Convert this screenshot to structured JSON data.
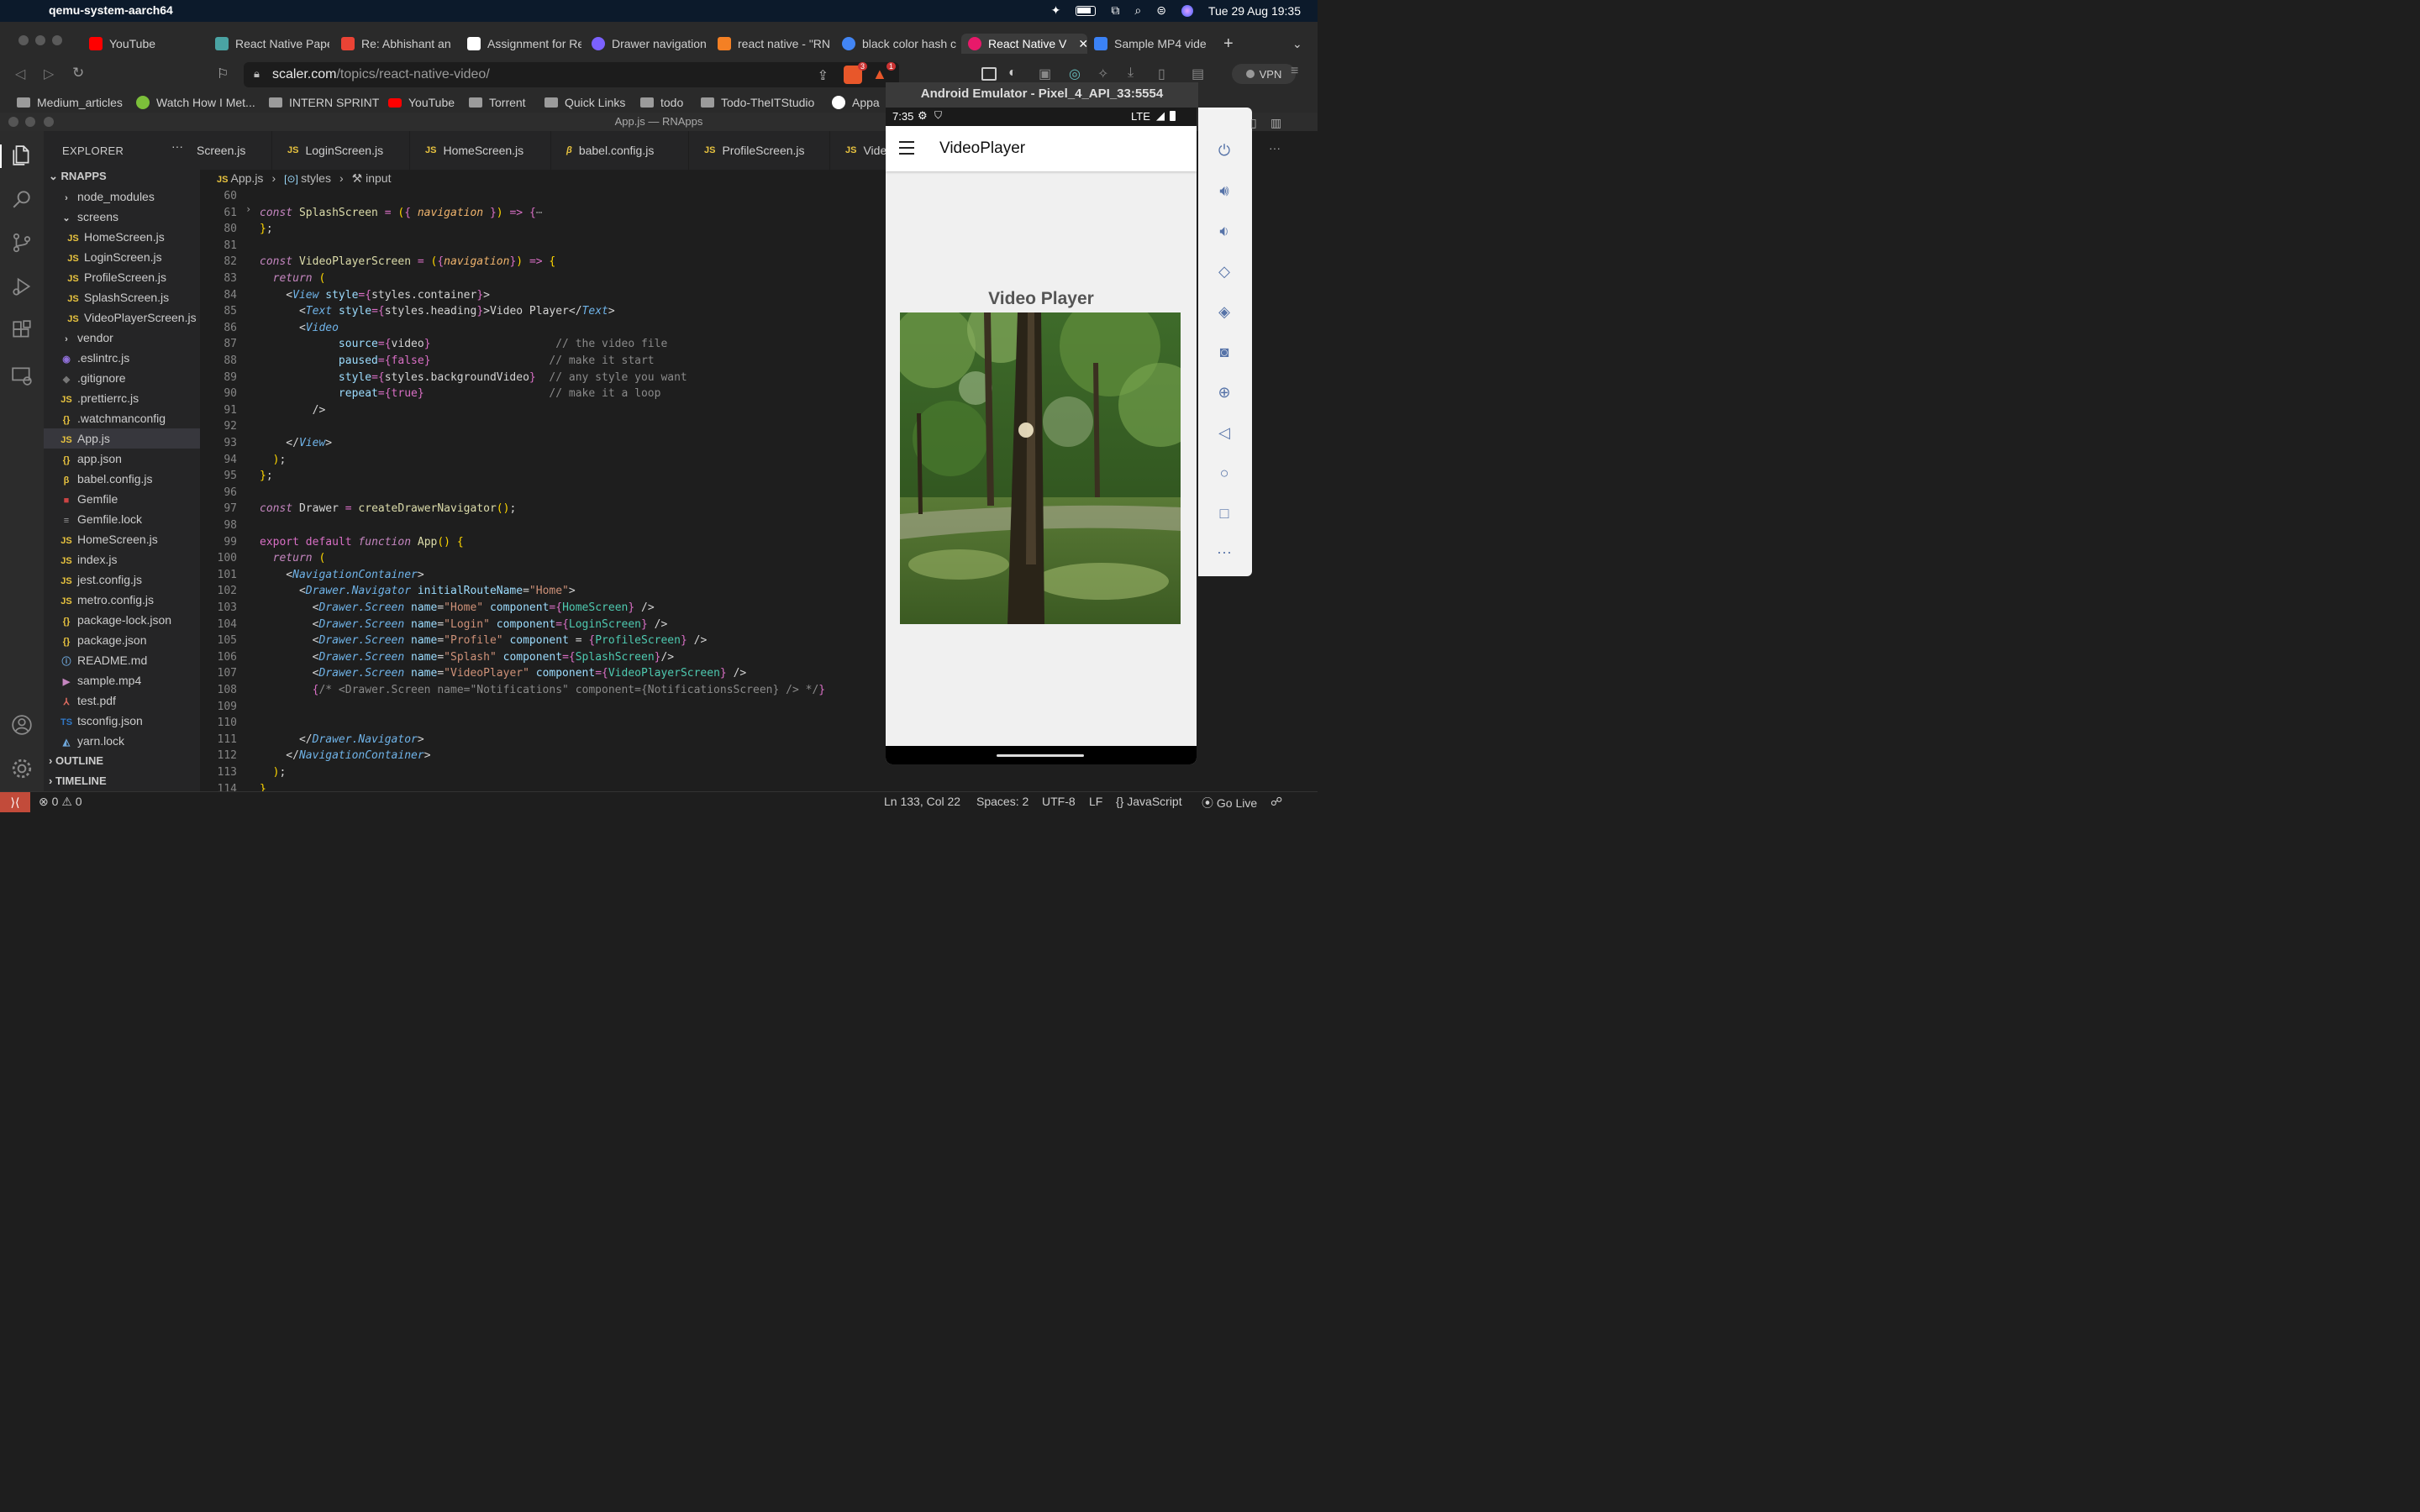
{
  "menubar": {
    "app_name": "qemu-system-aarch64",
    "datetime": "Tue 29 Aug  19:35"
  },
  "browser": {
    "tabs": [
      {
        "label": "YouTube",
        "color": "#ff0000"
      },
      {
        "label": "React Native Pape",
        "color": "#4aa3a3"
      },
      {
        "label": "Re: Abhishant an",
        "color": "#ea4335"
      },
      {
        "label": "Assignment for Re",
        "color": "#ffffff"
      },
      {
        "label": "Drawer navigation",
        "color": "#7b61ff"
      },
      {
        "label": "react native - \"RN",
        "color": "#f48024"
      },
      {
        "label": "black color hash c",
        "color": "#4285f4"
      },
      {
        "label": "React Native V",
        "color": "#e8196a"
      },
      {
        "label": "Sample MP4 vide",
        "color": "#3b82f6"
      }
    ],
    "url_domain": "scaler.com",
    "url_path": "/topics/react-native-video/",
    "vpn_label": "VPN",
    "shield_badge": "3",
    "alert_badge": "1",
    "bookmarks": [
      "Medium_articles",
      "Watch How I Met...",
      "INTERN SPRINT",
      "YouTube",
      "Torrent",
      "Quick Links",
      "todo",
      "Todo-TheITStudio",
      "Appa"
    ]
  },
  "vscode": {
    "window_title": "App.js — RNApps",
    "explorer_title": "EXPLORER",
    "project": "RNAPPS",
    "files": [
      {
        "name": "node_modules",
        "type": "folder",
        "indent": 1
      },
      {
        "name": "screens",
        "type": "folder-open",
        "indent": 1
      },
      {
        "name": "HomeScreen.js",
        "type": "js",
        "indent": 2
      },
      {
        "name": "LoginScreen.js",
        "type": "js",
        "indent": 2
      },
      {
        "name": "ProfileScreen.js",
        "type": "js",
        "indent": 2
      },
      {
        "name": "SplashScreen.js",
        "type": "js",
        "indent": 2
      },
      {
        "name": "VideoPlayerScreen.js",
        "type": "js",
        "indent": 2
      },
      {
        "name": "vendor",
        "type": "folder",
        "indent": 1
      },
      {
        "name": ".eslintrc.js",
        "type": "eslint",
        "indent": 1
      },
      {
        "name": ".gitignore",
        "type": "git",
        "indent": 1
      },
      {
        "name": ".prettierrc.js",
        "type": "js",
        "indent": 1
      },
      {
        "name": ".watchmanconfig",
        "type": "json",
        "indent": 1
      },
      {
        "name": "App.js",
        "type": "js",
        "indent": 1,
        "selected": true
      },
      {
        "name": "app.json",
        "type": "json",
        "indent": 1
      },
      {
        "name": "babel.config.js",
        "type": "babel",
        "indent": 1
      },
      {
        "name": "Gemfile",
        "type": "ruby",
        "indent": 1
      },
      {
        "name": "Gemfile.lock",
        "type": "lock",
        "indent": 1
      },
      {
        "name": "HomeScreen.js",
        "type": "js",
        "indent": 1
      },
      {
        "name": "index.js",
        "type": "js",
        "indent": 1
      },
      {
        "name": "jest.config.js",
        "type": "js",
        "indent": 1
      },
      {
        "name": "metro.config.js",
        "type": "js",
        "indent": 1
      },
      {
        "name": "package-lock.json",
        "type": "json",
        "indent": 1
      },
      {
        "name": "package.json",
        "type": "json",
        "indent": 1
      },
      {
        "name": "README.md",
        "type": "info",
        "indent": 1
      },
      {
        "name": "sample.mp4",
        "type": "media",
        "indent": 1
      },
      {
        "name": "test.pdf",
        "type": "pdf",
        "indent": 1
      },
      {
        "name": "tsconfig.json",
        "type": "ts",
        "indent": 1
      },
      {
        "name": "yarn.lock",
        "type": "yarn",
        "indent": 1
      }
    ],
    "outline": "OUTLINE",
    "timeline": "TIMELINE",
    "editor_tabs": [
      "Screen.js",
      "LoginScreen.js",
      "HomeScreen.js",
      "babel.config.js",
      "ProfileScreen.js",
      "Vide"
    ],
    "breadcrumb": [
      "App.js",
      "styles",
      "input"
    ],
    "line_numbers": [
      "60",
      "61",
      "80",
      "81",
      "82",
      "83",
      "84",
      "85",
      "86",
      "87",
      "88",
      "89",
      "90",
      "91",
      "92",
      "93",
      "94",
      "95",
      "96",
      "97",
      "98",
      "99",
      "100",
      "101",
      "102",
      "103",
      "104",
      "105",
      "106",
      "107",
      "108",
      "109",
      "110",
      "111",
      "112",
      "113",
      "114"
    ],
    "status": {
      "errors": "0",
      "warnings": "0",
      "position": "Ln 133, Col 22",
      "spaces": "Spaces: 2",
      "encoding": "UTF-8",
      "eol": "LF",
      "language": "JavaScript",
      "golive": "Go Live"
    }
  },
  "emulator": {
    "title": "Android Emulator - Pixel_4_API_33:5554",
    "time": "7:35",
    "network": "LTE",
    "app_title": "VideoPlayer",
    "heading": "Video Player"
  }
}
